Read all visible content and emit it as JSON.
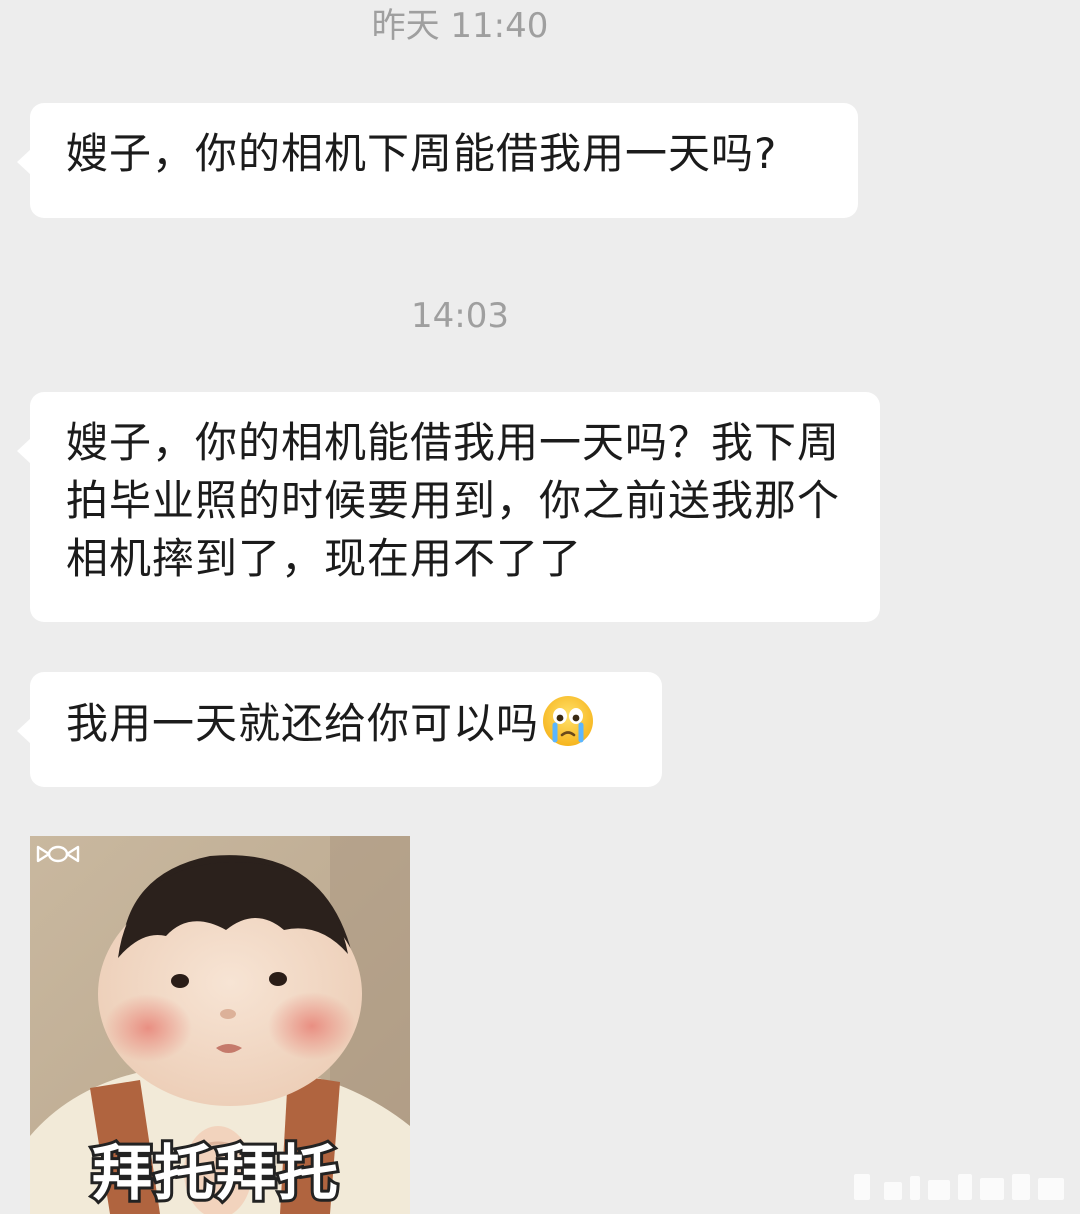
{
  "chat": {
    "timestamps": [
      "昨天 11:40",
      "14:03"
    ],
    "messages": [
      {
        "text": "嫂子，你的相机下周能借我用一天吗?"
      },
      {
        "text": "嫂子，你的相机能借我用一天吗？我下周拍毕业照的时候要用到，你之前送我那个相机摔到了，现在用不了了"
      },
      {
        "text": "我用一天就还给你可以吗",
        "emoji": "crying-face-emoji"
      }
    ],
    "sticker": {
      "caption": "拜托拜托",
      "icon": "candy-icon"
    }
  },
  "colors": {
    "background": "#ededed",
    "bubble": "#ffffff",
    "timestamp": "#9f9f9f",
    "text": "#1b1b1b"
  }
}
